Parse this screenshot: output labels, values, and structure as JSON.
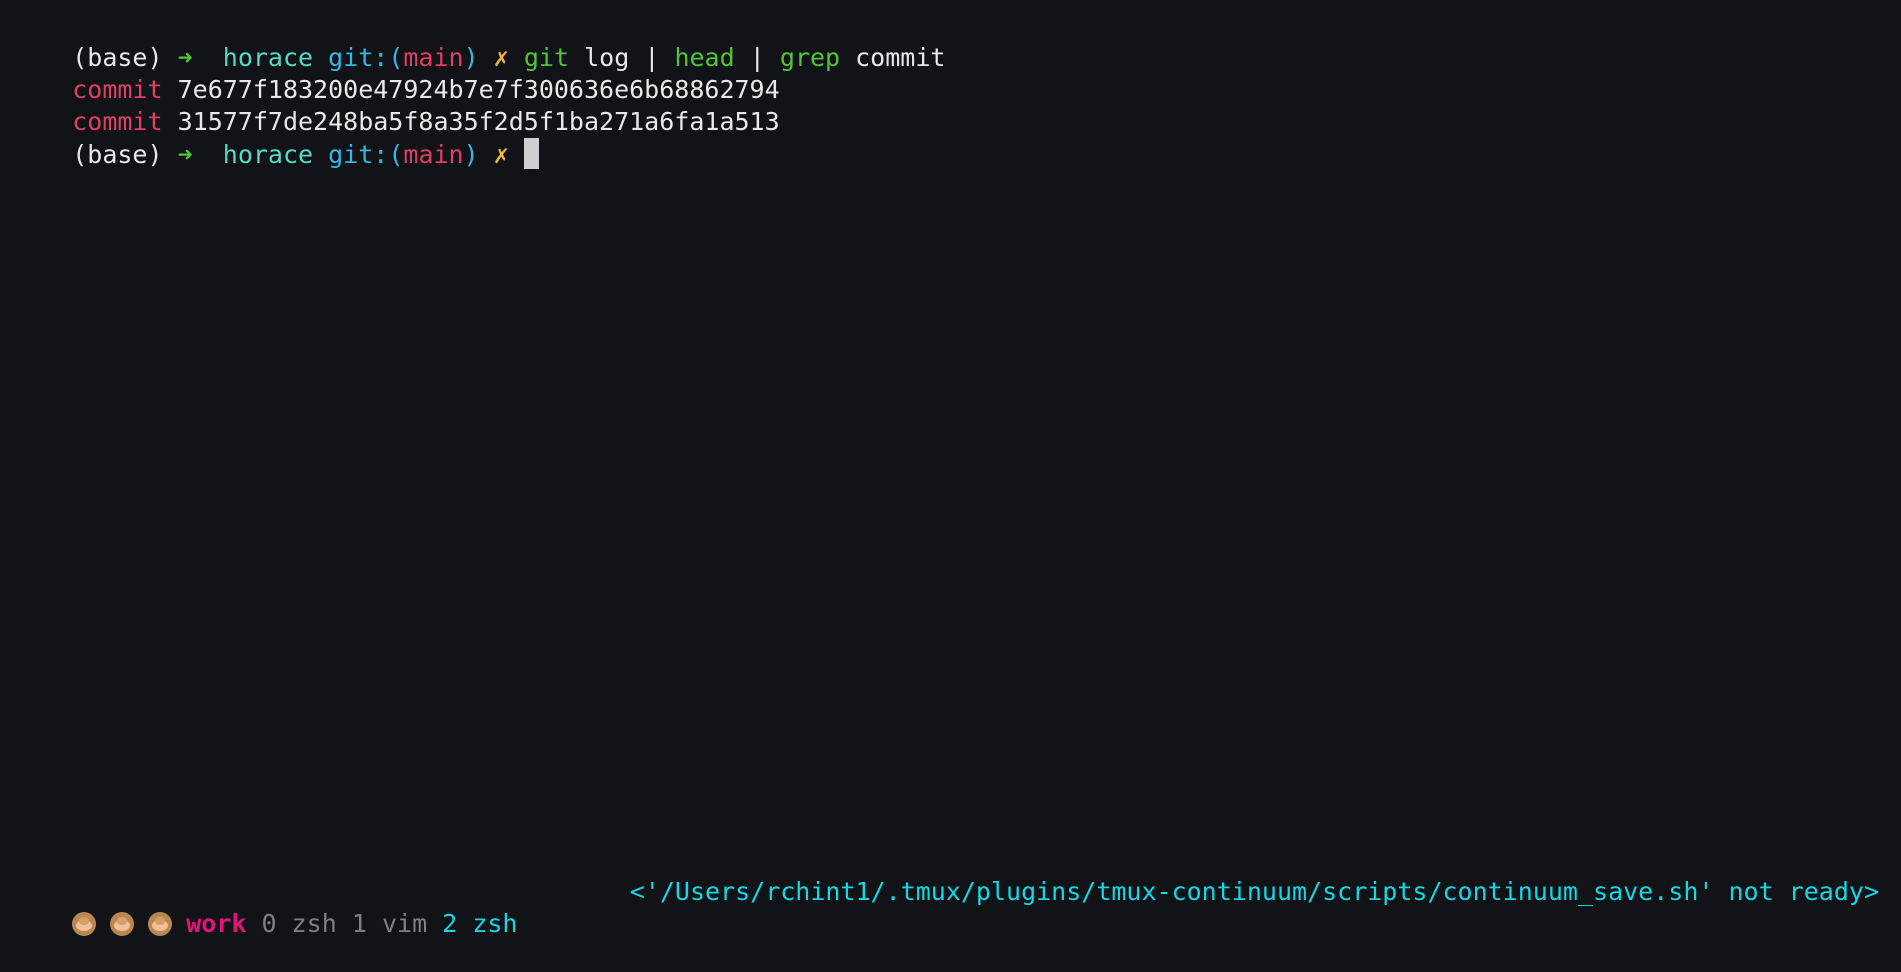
{
  "terminal": {
    "prompt": {
      "env": "(base)",
      "arrow": "➜",
      "directory": "horace",
      "git_label": "git:(",
      "branch": "main",
      "git_close": ")",
      "dirty_marker": "✗"
    },
    "command": {
      "git": "git",
      "log": "log",
      "pipe": "|",
      "head": "head",
      "grep": "grep",
      "commit": "commit"
    },
    "output": [
      {
        "label": "commit",
        "hash": "7e677f183200e47924b7e7f300636e6b68862794"
      },
      {
        "label": "commit",
        "hash": "31577f7de248ba5f8a35f2d5f1ba271a6fa1a513"
      }
    ]
  },
  "statusbar": {
    "icons": [
      "see-no-evil-monkey-icon",
      "hear-no-evil-monkey-icon",
      "speak-no-evil-monkey-icon"
    ],
    "session": "work",
    "windows": [
      {
        "index": "0",
        "name": "zsh"
      },
      {
        "index": "1",
        "name": "vim"
      },
      {
        "index": "2",
        "name": "zsh"
      }
    ],
    "message": "<'/Users/rchint1/.tmux/plugins/tmux-continuum/scripts/continuum_save.sh' not ready>"
  },
  "colors": {
    "background": "#111316",
    "text": "#e8e8e8",
    "green": "#51c43a",
    "cyan": "#56d9c9",
    "blue": "#35b7e5",
    "red": "#df3f65",
    "yellow": "#f0b53a",
    "magenta": "#e0157c",
    "status_cyan": "#15d7e5"
  }
}
